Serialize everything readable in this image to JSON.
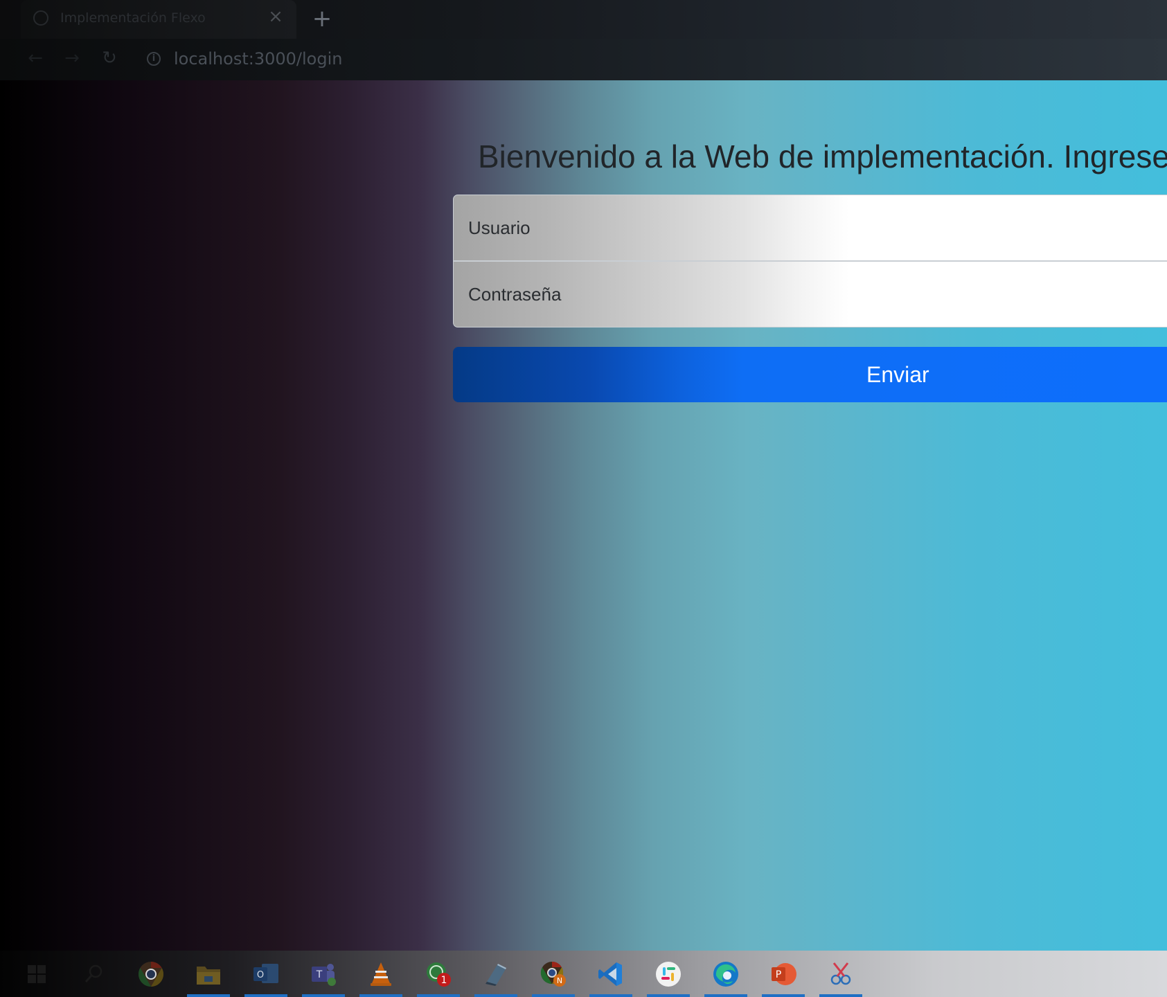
{
  "browser": {
    "tab": {
      "title": "Implementación Flexo",
      "close_symbol": "×",
      "favicon_icon": "globe-icon"
    },
    "new_tab_symbol": "+",
    "nav": {
      "back_symbol": "←",
      "forward_symbol": "→",
      "reload_symbol": "↻"
    },
    "address_bar": {
      "url": "localhost:3000/login",
      "info_symbol": "i"
    }
  },
  "login": {
    "title": "Bienvenido a la Web de implementación. Ingrese",
    "username_placeholder": "Usuario",
    "password_placeholder": "Contraseña",
    "submit_label": "Enviar"
  },
  "colors": {
    "button_primary": "#0d6efd",
    "title_text": "#212529",
    "taskbar_active": "#1f6fc4"
  },
  "taskbar": {
    "items": [
      {
        "name": "windows-start-icon",
        "underline": false
      },
      {
        "name": "search-icon",
        "underline": false
      },
      {
        "name": "chrome-icon",
        "underline": false
      },
      {
        "name": "file-explorer-icon",
        "underline": true
      },
      {
        "name": "outlook-icon",
        "underline": true
      },
      {
        "name": "teams-icon",
        "underline": true
      },
      {
        "name": "vlc-icon",
        "underline": true
      },
      {
        "name": "whatsapp-icon",
        "underline": true,
        "badge": "1"
      },
      {
        "name": "notepad-icon",
        "underline": true
      },
      {
        "name": "chrome-profile-icon",
        "underline": true,
        "badge": "N"
      },
      {
        "name": "vscode-icon",
        "underline": true
      },
      {
        "name": "slack-icon",
        "underline": true
      },
      {
        "name": "edge-icon",
        "underline": true
      },
      {
        "name": "powerpoint-icon",
        "underline": true
      },
      {
        "name": "snipping-tool-icon",
        "underline": true
      }
    ]
  }
}
